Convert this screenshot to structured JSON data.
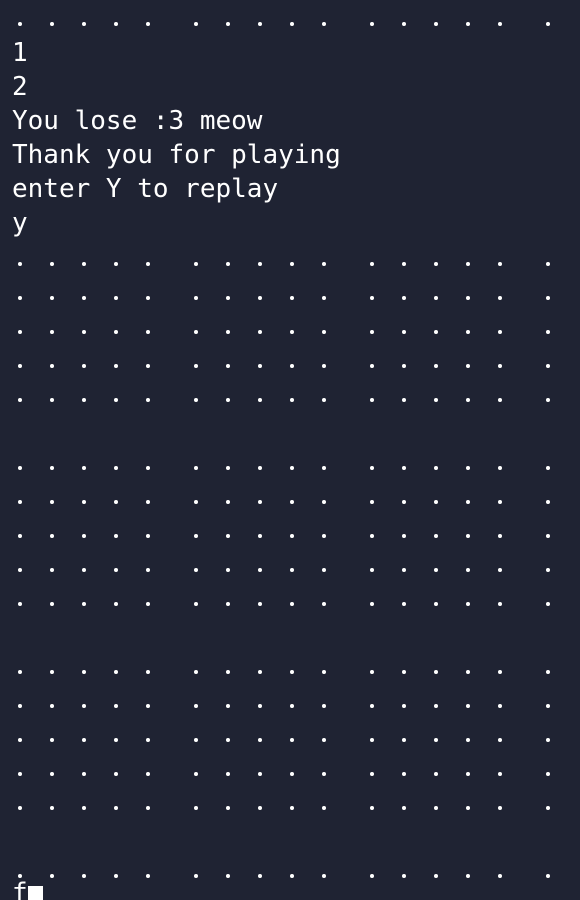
{
  "terminal": {
    "dot_char": "•",
    "output_lines": [
      "1",
      "2",
      "You lose :3 meow",
      "Thank you for playing",
      "enter Y to replay",
      "y"
    ],
    "input_text": "f"
  },
  "colors": {
    "background": "#1f2333",
    "foreground": "#ffffff"
  }
}
